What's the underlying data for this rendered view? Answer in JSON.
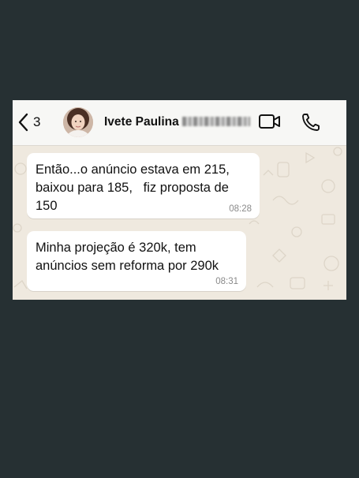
{
  "header": {
    "back_count": "3",
    "contact_name": "Ivete Paulina",
    "icons": {
      "back": "chevron-left-icon",
      "video": "video-camera-icon",
      "phone": "phone-icon"
    }
  },
  "messages": [
    {
      "text": "Então...o anúncio estava em 215,\nbaixou para 185,   fiz proposta de\n150",
      "time": "08:28"
    },
    {
      "text": "Minha projeção é 320k, tem\nanúncios sem reforma por 290k",
      "time": "08:31"
    }
  ],
  "colors": {
    "page_background": "#263033",
    "chat_wallpaper": "#efe9df",
    "bubble": "#ffffff",
    "header": "#f7f7f5"
  }
}
